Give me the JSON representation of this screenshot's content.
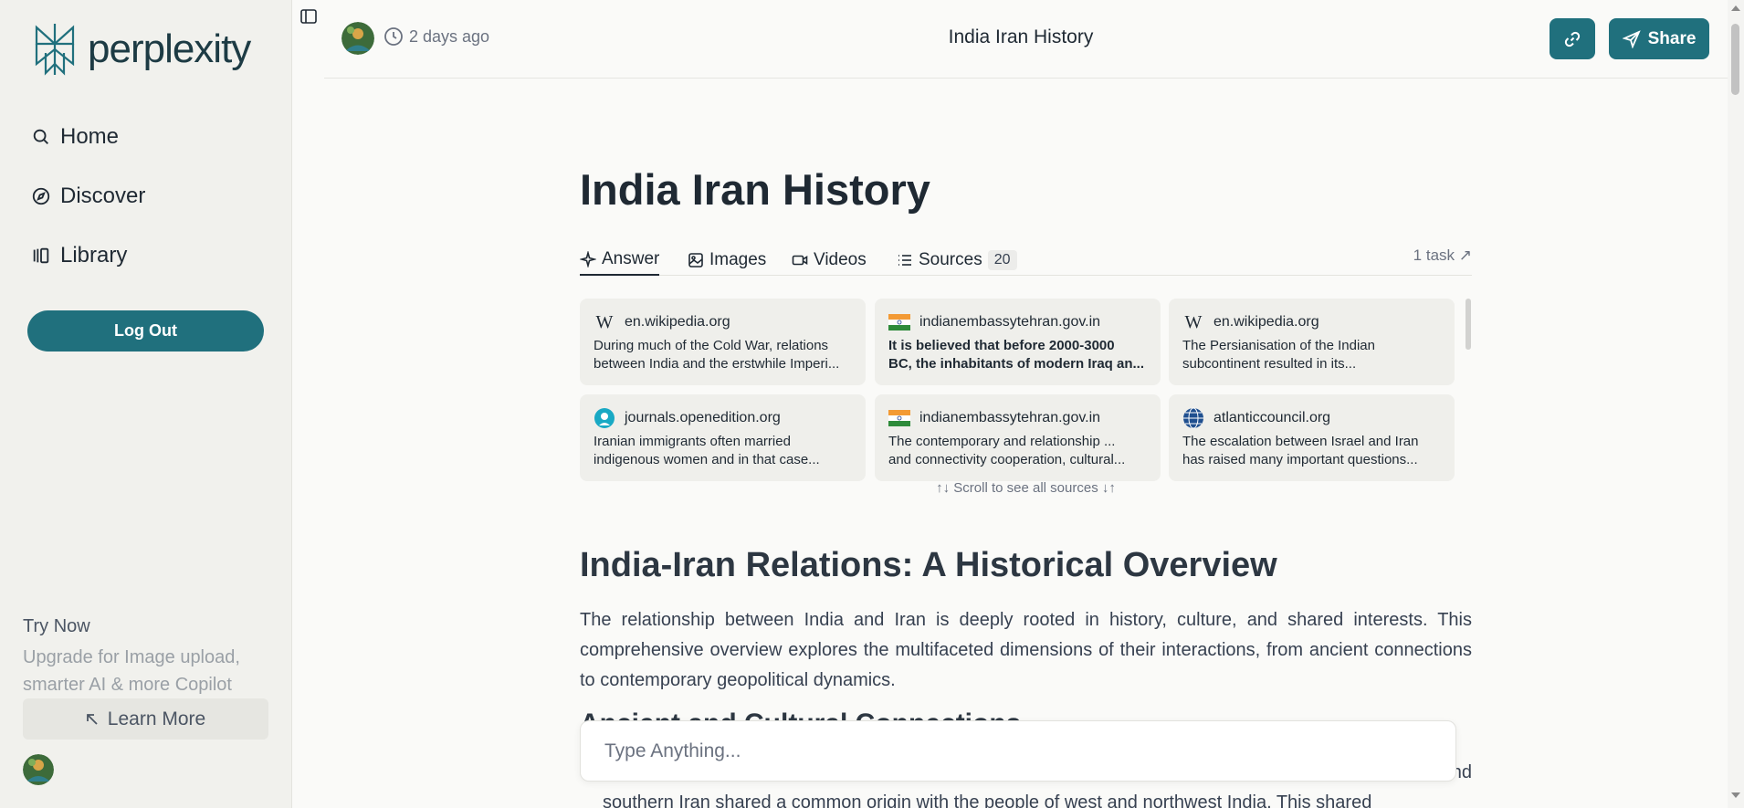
{
  "sidebar": {
    "brand": "perplexity",
    "nav": [
      {
        "label": "Home",
        "icon": "search-icon"
      },
      {
        "label": "Discover",
        "icon": "compass-icon"
      },
      {
        "label": "Library",
        "icon": "library-icon"
      }
    ],
    "logout_label": "Log Out",
    "try_now": "Try Now",
    "upgrade_text": "Upgrade for Image upload, smarter AI & more Copilot",
    "learn_more_label": "Learn More"
  },
  "header": {
    "time_ago": "2 days ago",
    "title": "India Iran History",
    "share_label": "Share"
  },
  "main": {
    "title": "India Iran History",
    "tabs": [
      {
        "label": "Answer",
        "icon": "sparkle-icon"
      },
      {
        "label": "Images",
        "icon": "image-icon"
      },
      {
        "label": "Videos",
        "icon": "video-icon"
      },
      {
        "label": "Sources",
        "icon": "list-icon",
        "count": "20"
      }
    ],
    "task_label": "1 task ↗",
    "sources": [
      {
        "domain": "en.wikipedia.org",
        "icon": "wikipedia-icon",
        "line1": "During much of the Cold War, relations",
        "line2": "between India and the erstwhile Imperi..."
      },
      {
        "domain": "indianembassytehran.gov.in",
        "icon": "india-flag-icon",
        "line1": "It is believed that before 2000-3000",
        "line2": "BC, the inhabitants of modern Iraq an..."
      },
      {
        "domain": "en.wikipedia.org",
        "icon": "wikipedia-icon",
        "line1": "The Persianisation of the Indian",
        "line2": "subcontinent resulted in its..."
      },
      {
        "domain": "journals.openedition.org",
        "icon": "openedition-icon",
        "line1": "Iranian immigrants often married",
        "line2": "indigenous women and in that case..."
      },
      {
        "domain": "indianembassytehran.gov.in",
        "icon": "india-flag-icon",
        "line1": "The contemporary and relationship ...",
        "line2": "and connectivity cooperation, cultural..."
      },
      {
        "domain": "atlanticcouncil.org",
        "icon": "globe-icon",
        "line1": "The escalation between Israel and Iran",
        "line2": "has raised many important questions..."
      }
    ],
    "scroll_hint": "↑↓ Scroll to see all sources ↓↑",
    "section_title": "India-Iran Relations: A Historical Overview",
    "intro": "The relationship between India and Iran is deeply rooted in history, culture, and shared interests. This comprehensive overview explores the multifaceted dimensions of their interactions, from ancient connections to contemporary geopolitical dynamics.",
    "subheading": "Ancient and Cultural Connections",
    "para2_line1": "nd",
    "para2_line2": "southern Iran shared a common origin with the people of west and northwest India. This shared"
  },
  "composer": {
    "placeholder": "Type Anything..."
  },
  "colors": {
    "accent": "#20707d",
    "sidebar_bg": "#f1f1ed",
    "page_bg": "#fafaf8"
  }
}
